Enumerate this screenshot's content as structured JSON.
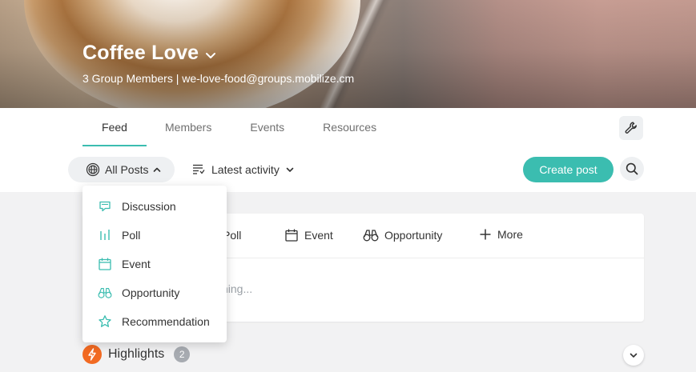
{
  "group": {
    "title": "Coffee Love",
    "subtitle": "3 Group Members | we-love-food@groups.mobilize.cm"
  },
  "tabs": [
    {
      "label": "Feed",
      "active": true
    },
    {
      "label": "Members",
      "active": false
    },
    {
      "label": "Events",
      "active": false
    },
    {
      "label": "Resources",
      "active": false
    }
  ],
  "toolbar": {
    "filter_label": "All Posts",
    "sort_label": "Latest activity",
    "create_label": "Create post"
  },
  "composer": {
    "types": [
      {
        "label": "Poll",
        "icon": "poll-icon"
      },
      {
        "label": "Event",
        "icon": "calendar-icon"
      },
      {
        "label": "Opportunity",
        "icon": "binoculars-icon"
      },
      {
        "label": "More",
        "icon": "plus-icon"
      }
    ],
    "placeholder": "hing..."
  },
  "dropdown": {
    "items": [
      {
        "label": "Discussion",
        "icon": "chat-bubble-icon"
      },
      {
        "label": "Poll",
        "icon": "poll-icon"
      },
      {
        "label": "Event",
        "icon": "calendar-icon"
      },
      {
        "label": "Opportunity",
        "icon": "binoculars-icon"
      },
      {
        "label": "Recommendation",
        "icon": "star-icon"
      }
    ]
  },
  "highlights": {
    "label": "Highlights",
    "count": "2"
  },
  "colors": {
    "accent": "#3bbdb0",
    "highlight_badge": "#f26a22",
    "count_badge": "#a7abb1"
  }
}
